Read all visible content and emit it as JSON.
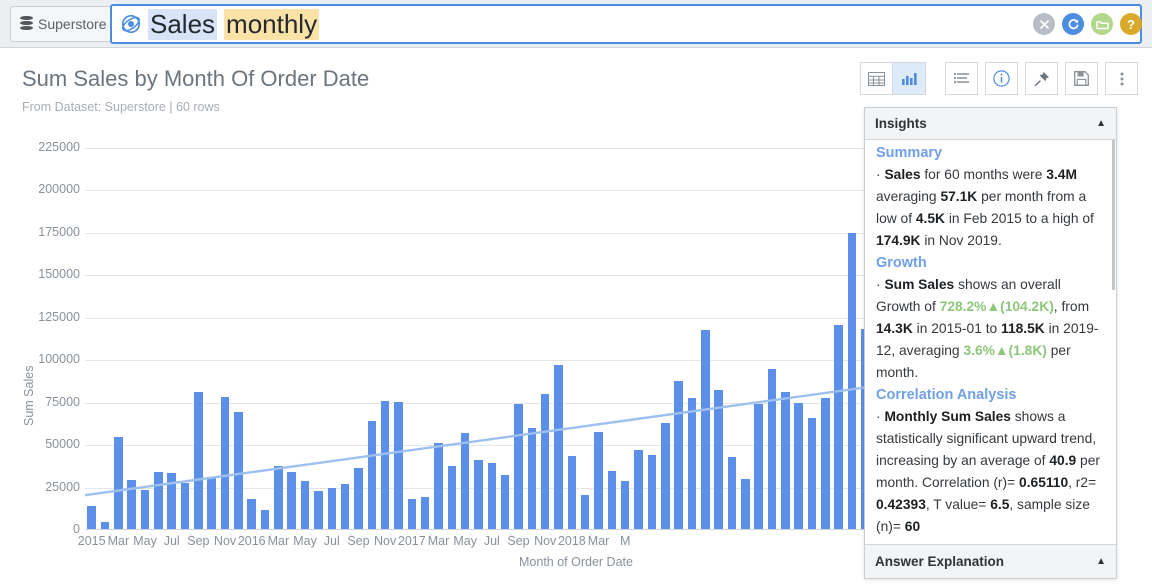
{
  "topbar": {
    "dataset_button": "Superstore",
    "dataset_icon": "database-icon",
    "search_icon": "orbit-search-icon",
    "query_column": "Sales",
    "query_keyword": "monthly",
    "actions": [
      {
        "name": "clear-search-button",
        "glyph": "✕",
        "color": "#b8bec4"
      },
      {
        "name": "refresh-button",
        "glyph": "↻",
        "color": "#4c8ddf"
      },
      {
        "name": "folder-button",
        "glyph": "▱",
        "color": "#b3d88c"
      },
      {
        "name": "help-button",
        "glyph": "?",
        "color": "#d8a92b"
      }
    ]
  },
  "header": {
    "title": "Sum Sales by Month Of Order Date",
    "subtitle": "From Dataset: Superstore | 60 rows"
  },
  "toolbar": {
    "view_buttons": [
      {
        "name": "table-view-button",
        "icon": "table-grid-icon",
        "active": false
      },
      {
        "name": "chart-view-button",
        "icon": "bar-chart-icon",
        "active": true
      }
    ],
    "action_buttons": [
      {
        "name": "fields-button",
        "icon": "list-settings-icon"
      },
      {
        "name": "info-button",
        "icon": "info-circle-icon"
      },
      {
        "name": "pin-button",
        "icon": "pin-icon"
      },
      {
        "name": "save-button",
        "icon": "floppy-disk-icon"
      },
      {
        "name": "more-button",
        "icon": "kebab-menu-icon"
      }
    ]
  },
  "insights": {
    "title": "Insights",
    "collapse_icon": "caret-up-icon",
    "footer_title": "Answer Explanation",
    "footer_icon": "caret-up-icon",
    "sections": [
      {
        "heading": "Summary",
        "text_parts": [
          {
            "t": "· ",
            "s": "plain"
          },
          {
            "t": "Sales",
            "s": "bold"
          },
          {
            "t": " for 60 months were ",
            "s": "plain"
          },
          {
            "t": "3.4M",
            "s": "bold"
          },
          {
            "t": " averaging ",
            "s": "plain"
          },
          {
            "t": "57.1K",
            "s": "bold"
          },
          {
            "t": " per month from a low of ",
            "s": "plain"
          },
          {
            "t": "4.5K",
            "s": "bold"
          },
          {
            "t": " in Feb 2015 to a high of ",
            "s": "plain"
          },
          {
            "t": "174.9K",
            "s": "bold"
          },
          {
            "t": " in Nov 2019.",
            "s": "plain"
          }
        ]
      },
      {
        "heading": "Growth",
        "text_parts": [
          {
            "t": "· ",
            "s": "plain"
          },
          {
            "t": "Sum Sales",
            "s": "bold"
          },
          {
            "t": " shows an overall Growth of ",
            "s": "plain"
          },
          {
            "t": "728.2%▲(104.2K)",
            "s": "up"
          },
          {
            "t": ", from ",
            "s": "plain"
          },
          {
            "t": "14.3K",
            "s": "bold"
          },
          {
            "t": " in 2015-01 to ",
            "s": "plain"
          },
          {
            "t": "118.5K",
            "s": "bold"
          },
          {
            "t": " in 2019-12, averaging ",
            "s": "plain"
          },
          {
            "t": "3.6%▲(1.8K)",
            "s": "up"
          },
          {
            "t": " per month.",
            "s": "plain"
          }
        ]
      },
      {
        "heading": "Correlation Analysis",
        "text_parts": [
          {
            "t": "· ",
            "s": "plain"
          },
          {
            "t": "Monthly Sum Sales",
            "s": "bold"
          },
          {
            "t": " shows a statistically significant upward trend, increasing by an average of ",
            "s": "plain"
          },
          {
            "t": "40.9",
            "s": "bold"
          },
          {
            "t": " per month. Correlation (r)= ",
            "s": "plain"
          },
          {
            "t": "0.65110",
            "s": "bold"
          },
          {
            "t": ", r2= ",
            "s": "plain"
          },
          {
            "t": "0.42393",
            "s": "bold"
          },
          {
            "t": ", T value= ",
            "s": "plain"
          },
          {
            "t": "6.5",
            "s": "bold"
          },
          {
            "t": ", sample size (n)= ",
            "s": "plain"
          },
          {
            "t": "60",
            "s": "bold"
          }
        ]
      }
    ]
  },
  "chart_data": {
    "type": "bar",
    "title": "Sum Sales by Month Of Order Date",
    "xlabel": "Month of Order Date",
    "ylabel": "Sum Sales",
    "ylim": [
      0,
      225000
    ],
    "ytick_step": 25000,
    "yticks": [
      0,
      25000,
      50000,
      75000,
      100000,
      125000,
      150000,
      175000,
      200000,
      225000
    ],
    "grid": true,
    "legend": "none",
    "bar_color": "#5b8fe8",
    "trendline": {
      "color": "#9dc0ef",
      "label": "linear trend",
      "y_start": 20500,
      "y_end": 84500
    },
    "categories": [
      "2015-01",
      "2015-02",
      "2015-03",
      "2015-04",
      "2015-05",
      "2015-06",
      "2015-07",
      "2015-08",
      "2015-09",
      "2015-10",
      "2015-11",
      "2015-12",
      "2016-01",
      "2016-02",
      "2016-03",
      "2016-04",
      "2016-05",
      "2016-06",
      "2016-07",
      "2016-08",
      "2016-09",
      "2016-10",
      "2016-11",
      "2016-12",
      "2017-01",
      "2017-02",
      "2017-03",
      "2017-04",
      "2017-05",
      "2017-06",
      "2017-07",
      "2017-08",
      "2017-09",
      "2017-10",
      "2017-11",
      "2017-12",
      "2018-01",
      "2018-02",
      "2018-03",
      "2018-04",
      "2018-05",
      "2018-06",
      "2018-07",
      "2018-08",
      "2018-09",
      "2018-10",
      "2018-11",
      "2018-12",
      "2019-01",
      "2019-02",
      "2019-03",
      "2019-04",
      "2019-05",
      "2019-06",
      "2019-07",
      "2019-08",
      "2019-09",
      "2019-10",
      "2019-11",
      "2019-12"
    ],
    "xtick_labels": [
      {
        "index": 0,
        "label": "2015"
      },
      {
        "index": 2,
        "label": "Mar"
      },
      {
        "index": 4,
        "label": "May"
      },
      {
        "index": 6,
        "label": "Jul"
      },
      {
        "index": 8,
        "label": "Sep"
      },
      {
        "index": 10,
        "label": "Nov"
      },
      {
        "index": 12,
        "label": "2016"
      },
      {
        "index": 14,
        "label": "Mar"
      },
      {
        "index": 16,
        "label": "May"
      },
      {
        "index": 18,
        "label": "Jul"
      },
      {
        "index": 20,
        "label": "Sep"
      },
      {
        "index": 22,
        "label": "Nov"
      },
      {
        "index": 24,
        "label": "2017"
      },
      {
        "index": 26,
        "label": "Mar"
      },
      {
        "index": 28,
        "label": "May"
      },
      {
        "index": 30,
        "label": "Jul"
      },
      {
        "index": 32,
        "label": "Sep"
      },
      {
        "index": 34,
        "label": "Nov"
      },
      {
        "index": 36,
        "label": "2018"
      },
      {
        "index": 38,
        "label": "Mar"
      },
      {
        "index": 40,
        "label": "M"
      }
    ],
    "values": [
      14300,
      4500,
      55000,
      29500,
      23500,
      34000,
      33500,
      27500,
      81500,
      31500,
      78500,
      69500,
      18500,
      11500,
      38000,
      34000,
      29000,
      23000,
      25000,
      27000,
      36500,
      64000,
      76000,
      75500,
      18000,
      19500,
      51000,
      38000,
      57000,
      41000,
      39500,
      32500,
      74500,
      60000,
      80000,
      97000,
      43500,
      20500,
      58000,
      35000,
      29000,
      47000,
      44000,
      63000,
      87500,
      78000,
      118000,
      82500,
      43000,
      30000,
      74000,
      95000,
      81000,
      75000,
      66000,
      78000,
      121000,
      174900,
      118500
    ]
  }
}
